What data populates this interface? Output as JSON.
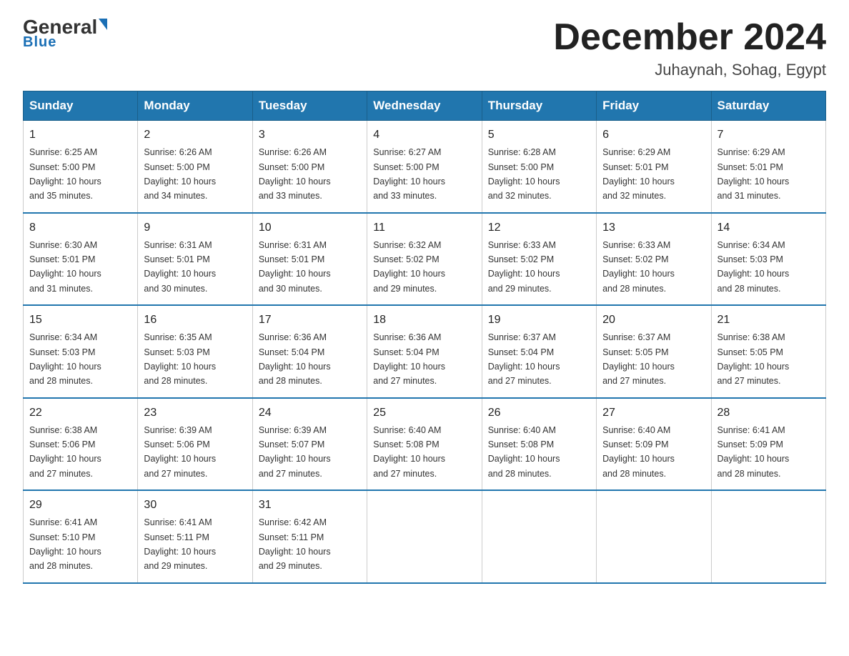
{
  "logo": {
    "text_general": "General",
    "text_blue": "Blue",
    "triangle": "▶"
  },
  "header": {
    "month_year": "December 2024",
    "location": "Juhaynah, Sohag, Egypt"
  },
  "days_of_week": [
    "Sunday",
    "Monday",
    "Tuesday",
    "Wednesday",
    "Thursday",
    "Friday",
    "Saturday"
  ],
  "weeks": [
    [
      {
        "day": "1",
        "sunrise": "6:25 AM",
        "sunset": "5:00 PM",
        "daylight": "10 hours and 35 minutes."
      },
      {
        "day": "2",
        "sunrise": "6:26 AM",
        "sunset": "5:00 PM",
        "daylight": "10 hours and 34 minutes."
      },
      {
        "day": "3",
        "sunrise": "6:26 AM",
        "sunset": "5:00 PM",
        "daylight": "10 hours and 33 minutes."
      },
      {
        "day": "4",
        "sunrise": "6:27 AM",
        "sunset": "5:00 PM",
        "daylight": "10 hours and 33 minutes."
      },
      {
        "day": "5",
        "sunrise": "6:28 AM",
        "sunset": "5:00 PM",
        "daylight": "10 hours and 32 minutes."
      },
      {
        "day": "6",
        "sunrise": "6:29 AM",
        "sunset": "5:01 PM",
        "daylight": "10 hours and 32 minutes."
      },
      {
        "day": "7",
        "sunrise": "6:29 AM",
        "sunset": "5:01 PM",
        "daylight": "10 hours and 31 minutes."
      }
    ],
    [
      {
        "day": "8",
        "sunrise": "6:30 AM",
        "sunset": "5:01 PM",
        "daylight": "10 hours and 31 minutes."
      },
      {
        "day": "9",
        "sunrise": "6:31 AM",
        "sunset": "5:01 PM",
        "daylight": "10 hours and 30 minutes."
      },
      {
        "day": "10",
        "sunrise": "6:31 AM",
        "sunset": "5:01 PM",
        "daylight": "10 hours and 30 minutes."
      },
      {
        "day": "11",
        "sunrise": "6:32 AM",
        "sunset": "5:02 PM",
        "daylight": "10 hours and 29 minutes."
      },
      {
        "day": "12",
        "sunrise": "6:33 AM",
        "sunset": "5:02 PM",
        "daylight": "10 hours and 29 minutes."
      },
      {
        "day": "13",
        "sunrise": "6:33 AM",
        "sunset": "5:02 PM",
        "daylight": "10 hours and 28 minutes."
      },
      {
        "day": "14",
        "sunrise": "6:34 AM",
        "sunset": "5:03 PM",
        "daylight": "10 hours and 28 minutes."
      }
    ],
    [
      {
        "day": "15",
        "sunrise": "6:34 AM",
        "sunset": "5:03 PM",
        "daylight": "10 hours and 28 minutes."
      },
      {
        "day": "16",
        "sunrise": "6:35 AM",
        "sunset": "5:03 PM",
        "daylight": "10 hours and 28 minutes."
      },
      {
        "day": "17",
        "sunrise": "6:36 AM",
        "sunset": "5:04 PM",
        "daylight": "10 hours and 28 minutes."
      },
      {
        "day": "18",
        "sunrise": "6:36 AM",
        "sunset": "5:04 PM",
        "daylight": "10 hours and 27 minutes."
      },
      {
        "day": "19",
        "sunrise": "6:37 AM",
        "sunset": "5:04 PM",
        "daylight": "10 hours and 27 minutes."
      },
      {
        "day": "20",
        "sunrise": "6:37 AM",
        "sunset": "5:05 PM",
        "daylight": "10 hours and 27 minutes."
      },
      {
        "day": "21",
        "sunrise": "6:38 AM",
        "sunset": "5:05 PM",
        "daylight": "10 hours and 27 minutes."
      }
    ],
    [
      {
        "day": "22",
        "sunrise": "6:38 AM",
        "sunset": "5:06 PM",
        "daylight": "10 hours and 27 minutes."
      },
      {
        "day": "23",
        "sunrise": "6:39 AM",
        "sunset": "5:06 PM",
        "daylight": "10 hours and 27 minutes."
      },
      {
        "day": "24",
        "sunrise": "6:39 AM",
        "sunset": "5:07 PM",
        "daylight": "10 hours and 27 minutes."
      },
      {
        "day": "25",
        "sunrise": "6:40 AM",
        "sunset": "5:08 PM",
        "daylight": "10 hours and 27 minutes."
      },
      {
        "day": "26",
        "sunrise": "6:40 AM",
        "sunset": "5:08 PM",
        "daylight": "10 hours and 28 minutes."
      },
      {
        "day": "27",
        "sunrise": "6:40 AM",
        "sunset": "5:09 PM",
        "daylight": "10 hours and 28 minutes."
      },
      {
        "day": "28",
        "sunrise": "6:41 AM",
        "sunset": "5:09 PM",
        "daylight": "10 hours and 28 minutes."
      }
    ],
    [
      {
        "day": "29",
        "sunrise": "6:41 AM",
        "sunset": "5:10 PM",
        "daylight": "10 hours and 28 minutes."
      },
      {
        "day": "30",
        "sunrise": "6:41 AM",
        "sunset": "5:11 PM",
        "daylight": "10 hours and 29 minutes."
      },
      {
        "day": "31",
        "sunrise": "6:42 AM",
        "sunset": "5:11 PM",
        "daylight": "10 hours and 29 minutes."
      },
      null,
      null,
      null,
      null
    ]
  ],
  "labels": {
    "sunrise": "Sunrise:",
    "sunset": "Sunset:",
    "daylight": "Daylight:"
  }
}
